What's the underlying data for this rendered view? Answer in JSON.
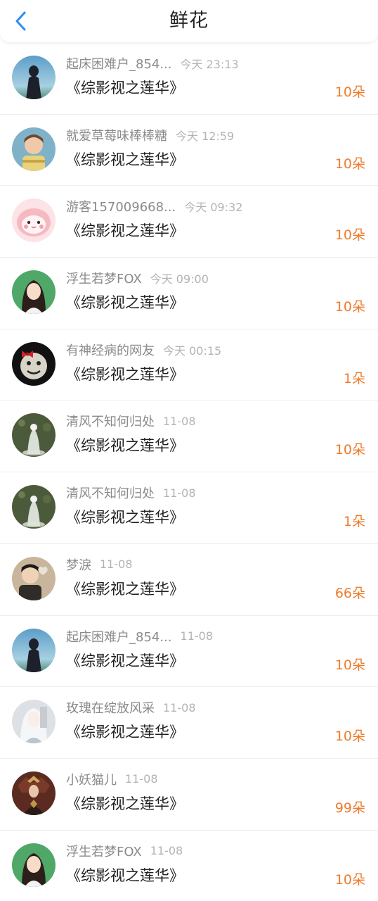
{
  "header": {
    "title": "鲜花",
    "back_icon": "chevron-left-icon",
    "accent": "#2a8df2"
  },
  "colors": {
    "count": "#ef7b2b",
    "name": "#8a8a8a",
    "time": "#b3b3b3"
  },
  "records": [
    {
      "name": "起床困难户_854...",
      "time": "今天 23:13",
      "book": "《综影视之莲华》",
      "count": "10朵",
      "avatar": "avatar-silhouette-sky"
    },
    {
      "name": "就爱草莓味棒棒糖",
      "time": "今天 12:59",
      "book": "《综影视之莲华》",
      "count": "10朵",
      "avatar": "avatar-boy-portrait"
    },
    {
      "name": "游客157009668...",
      "time": "今天 09:32",
      "book": "《综影视之莲华》",
      "count": "10朵",
      "avatar": "avatar-pink-cartoon"
    },
    {
      "name": "浮生若梦FOX",
      "time": "今天 09:00",
      "book": "《综影视之莲华》",
      "count": "10朵",
      "avatar": "avatar-girl-portrait"
    },
    {
      "name": "有神经病的网友",
      "time": "今天 00:15",
      "book": "《综影视之莲华》",
      "count": "1朵",
      "avatar": "avatar-meme-face"
    },
    {
      "name": "清风不知何归处",
      "time": "11-08",
      "book": "《综影视之莲华》",
      "count": "10朵",
      "avatar": "avatar-ghost-figure"
    },
    {
      "name": "清风不知何归处",
      "time": "11-08",
      "book": "《综影视之莲华》",
      "count": "1朵",
      "avatar": "avatar-ghost-figure"
    },
    {
      "name": "梦淚",
      "time": "11-08",
      "book": "《综影视之莲华》",
      "count": "66朵",
      "avatar": "avatar-boy-heart"
    },
    {
      "name": "起床困难户_854...",
      "time": "11-08",
      "book": "《综影视之莲华》",
      "count": "10朵",
      "avatar": "avatar-silhouette-sky"
    },
    {
      "name": "玫瑰在绽放风采",
      "time": "11-08",
      "book": "《综影视之莲华》",
      "count": "10朵",
      "avatar": "avatar-anime-girl"
    },
    {
      "name": "小妖猫儿",
      "time": "11-08",
      "book": "《综影视之莲华》",
      "count": "99朵",
      "avatar": "avatar-dark-queen"
    },
    {
      "name": "浮生若梦FOX",
      "time": "11-08",
      "book": "《综影视之莲华》",
      "count": "10朵",
      "avatar": "avatar-girl-portrait"
    }
  ]
}
